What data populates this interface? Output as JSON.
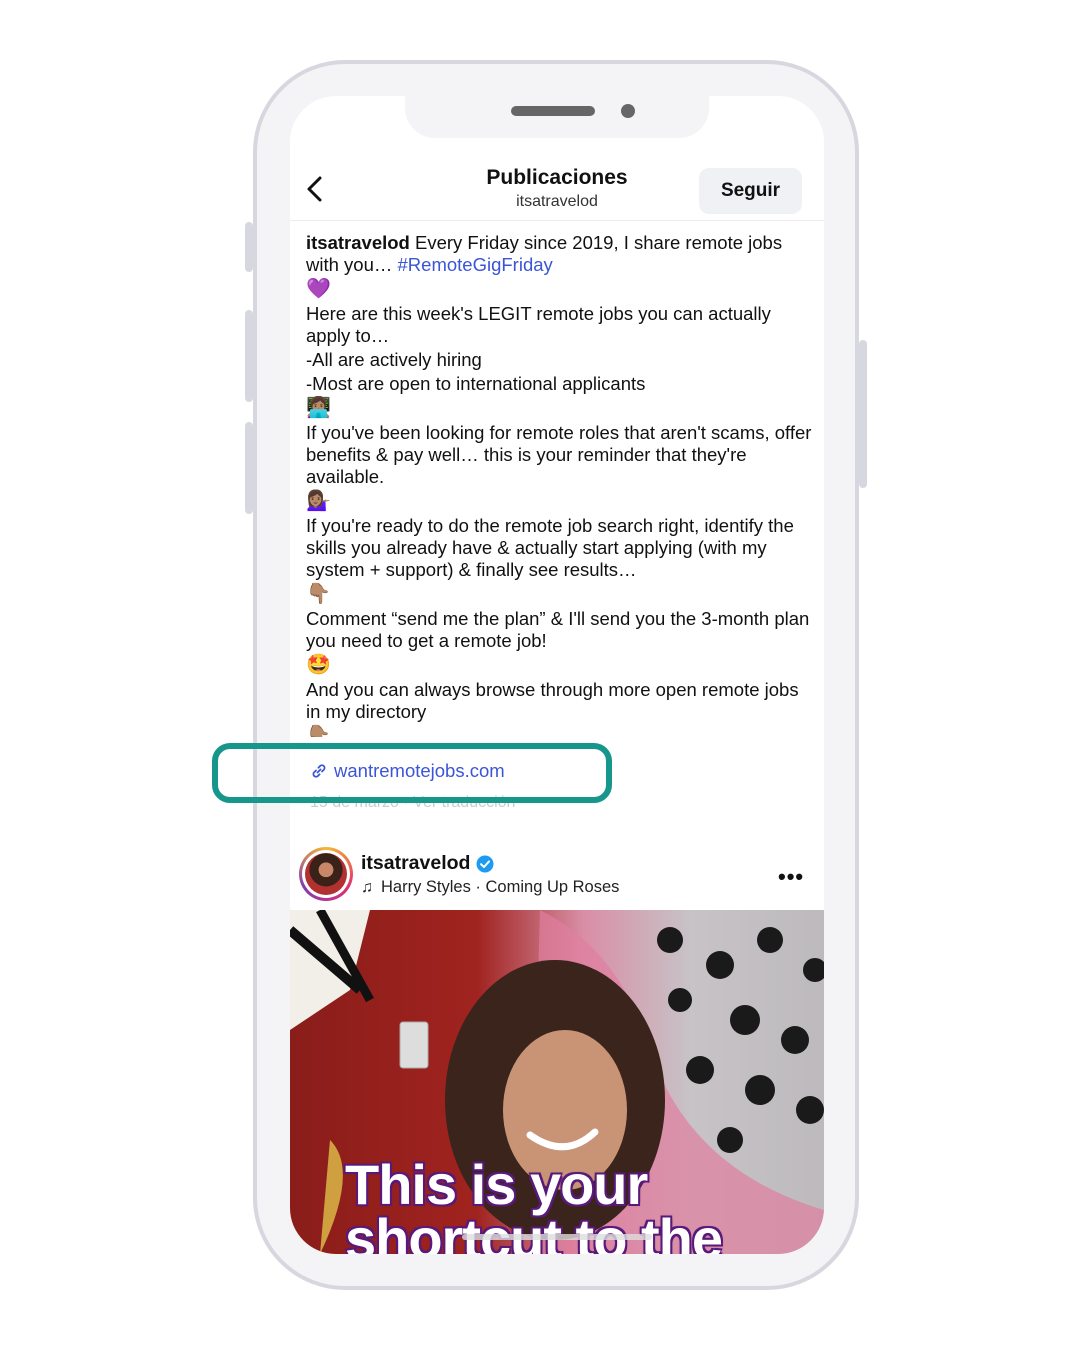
{
  "header": {
    "title": "Publicaciones",
    "subtitle": "itsatravelod",
    "follow_label": "Seguir"
  },
  "caption": {
    "username": "itsatravelod",
    "line1": " Every Friday since 2019, I share remote jobs with you… ",
    "hashtag": "#RemoteGigFriday",
    "emoji1": "💜",
    "p2": "Here are this week's LEGIT remote jobs you can actually apply to…",
    "p3": "-All are actively hiring",
    "p4": "-Most are open to international applicants",
    "emoji2": "👩🏽‍💻",
    "p5": "If you've been looking for remote roles that aren't scams, offer benefits & pay well… this is your reminder that they're available.",
    "emoji3": "💁🏽‍♀️",
    "p6": "If you're ready to do the remote job search right, identify the skills you already have & actually start applying (with my system + support) & finally see results…",
    "emoji4": "👇🏽",
    "p7": "Comment “send me the plan” & I'll send you the 3-month plan you need to get a remote job!",
    "emoji5": "🤩",
    "p8": "And you can always browse through more open remote jobs in my directory",
    "emoji6": "👇🏽",
    "link": "wantremotejobs.com",
    "faded_meta": "15 de marzo · Ver traducción"
  },
  "post": {
    "username": "itsatravelod",
    "music": "Harry Styles · Coming Up Roses",
    "more_label": "•••",
    "overlay_line1": "This is your",
    "overlay_line2": "shortcut to the"
  },
  "colors": {
    "link": "#3a55d6",
    "highlight": "#17968c",
    "verified": "#1d9bf0"
  }
}
